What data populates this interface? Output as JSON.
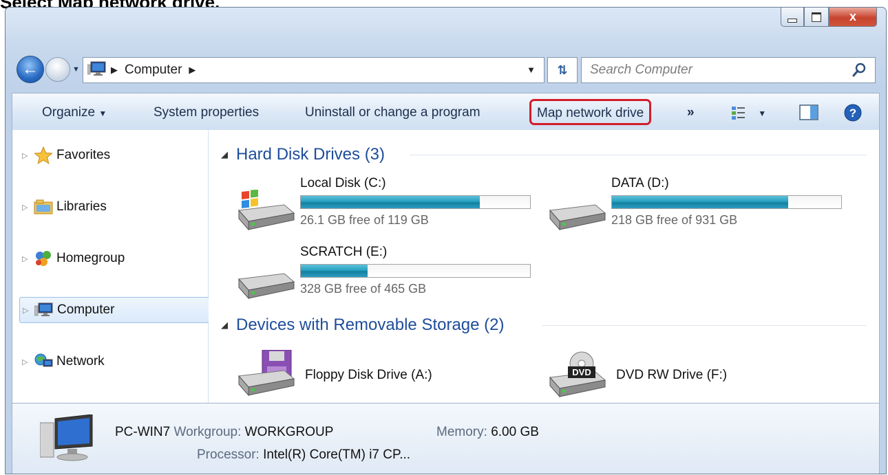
{
  "caption": "Select Map network drive.",
  "window": {
    "controls": {
      "close_label": "x"
    }
  },
  "address": {
    "crumbs": [
      "Computer"
    ],
    "search_placeholder": "Search Computer"
  },
  "toolbar": {
    "organize": "Organize",
    "system_properties": "System properties",
    "uninstall": "Uninstall or change a program",
    "map_network_drive": "Map network drive",
    "more": "»"
  },
  "nav": {
    "items": [
      {
        "label": "Favorites",
        "icon": "star-icon"
      },
      {
        "label": "Libraries",
        "icon": "libraries-icon"
      },
      {
        "label": "Homegroup",
        "icon": "homegroup-icon"
      },
      {
        "label": "Computer",
        "icon": "computer-icon",
        "selected": true
      },
      {
        "label": "Network",
        "icon": "network-icon"
      }
    ]
  },
  "groups": {
    "hdd": {
      "title": "Hard Disk Drives (3)",
      "drives": [
        {
          "name": "Local Disk (C:)",
          "free": "26.1 GB free of 119 GB",
          "used_fraction": 0.78,
          "icon": "windows-drive-icon"
        },
        {
          "name": "DATA (D:)",
          "free": "218 GB free of 931 GB",
          "used_fraction": 0.77,
          "icon": "hard-drive-icon"
        },
        {
          "name": "SCRATCH (E:)",
          "free": "328 GB free of 465 GB",
          "used_fraction": 0.29,
          "icon": "hard-drive-icon"
        }
      ]
    },
    "removable": {
      "title": "Devices with Removable Storage (2)",
      "devices": [
        {
          "name": "Floppy Disk Drive (A:)",
          "icon": "floppy-drive-icon"
        },
        {
          "name": "DVD RW Drive (F:)",
          "icon": "dvd-drive-icon",
          "badge": "DVD"
        }
      ]
    }
  },
  "details": {
    "pc_name": "PC-WIN7",
    "workgroup_label": "Workgroup:",
    "workgroup": "WORKGROUP",
    "memory_label": "Memory:",
    "memory": "6.00 GB",
    "processor_label": "Processor:",
    "processor": "Intel(R) Core(TM) i7 CP..."
  }
}
